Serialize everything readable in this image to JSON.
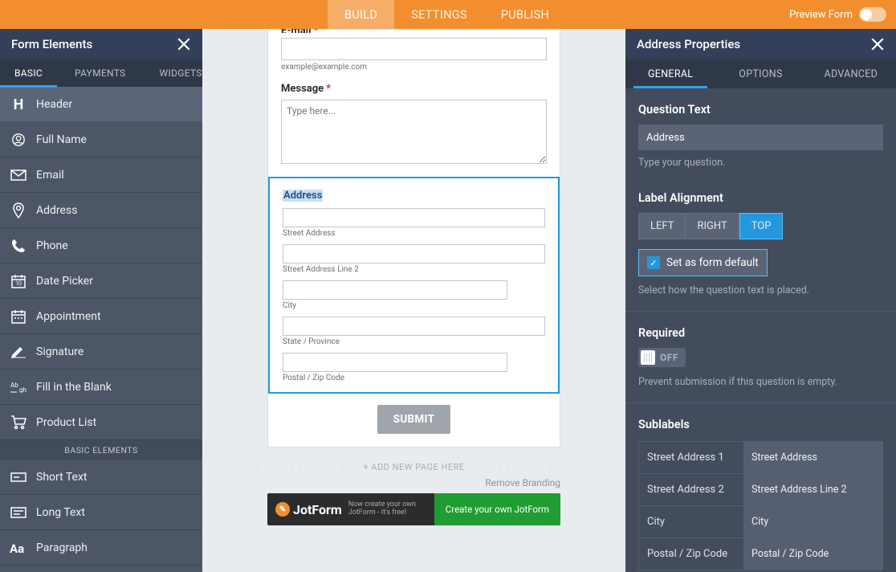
{
  "topbar": {
    "tabs": [
      "BUILD",
      "SETTINGS",
      "PUBLISH"
    ],
    "preview_label": "Preview Form"
  },
  "left": {
    "title": "Form Elements",
    "tabs": [
      "BASIC",
      "PAYMENTS",
      "WIDGETS"
    ],
    "items": [
      {
        "label": "Header"
      },
      {
        "label": "Full Name"
      },
      {
        "label": "Email"
      },
      {
        "label": "Address"
      },
      {
        "label": "Phone"
      },
      {
        "label": "Date Picker"
      },
      {
        "label": "Appointment"
      },
      {
        "label": "Signature"
      },
      {
        "label": "Fill in the Blank"
      },
      {
        "label": "Product List"
      }
    ],
    "section_label": "BASIC ELEMENTS",
    "items_more": [
      {
        "label": "Short Text"
      },
      {
        "label": "Long Text"
      },
      {
        "label": "Paragraph"
      }
    ]
  },
  "form": {
    "email_label": "E-mail",
    "email_hint": "example@example.com",
    "message_label": "Message",
    "message_placeholder": "Type here...",
    "address": {
      "label": "Address",
      "street1": "Street Address",
      "street2": "Street Address Line 2",
      "city": "City",
      "state": "State / Province",
      "postal": "Postal / Zip Code"
    },
    "submit": "SUBMIT",
    "add_page": "+ ADD NEW PAGE HERE",
    "remove_branding": "Remove Branding",
    "banner_brand": "JotForm",
    "banner_tag": "Now create your own JotForm - It's free!",
    "banner_btn": "Create your own JotForm"
  },
  "right": {
    "title": "Address Properties",
    "tabs": [
      "GENERAL",
      "OPTIONS",
      "ADVANCED"
    ],
    "q_label": "Question Text",
    "q_value": "Address",
    "q_hint": "Type your question.",
    "align_label": "Label Alignment",
    "align_options": [
      "LEFT",
      "RIGHT",
      "TOP"
    ],
    "align_selected": "TOP",
    "set_default": "Set as form default",
    "align_hint": "Select how the question text is placed.",
    "required_label": "Required",
    "required_off": "OFF",
    "required_hint": "Prevent submission if this question is empty.",
    "sublabels_label": "Sublabels",
    "sublabels": [
      {
        "key": "Street Address 1",
        "val": "Street Address"
      },
      {
        "key": "Street Address 2",
        "val": "Street Address Line 2"
      },
      {
        "key": "City",
        "val": "City"
      },
      {
        "key": "Postal / Zip Code",
        "val": "Postal / Zip Code"
      }
    ]
  }
}
